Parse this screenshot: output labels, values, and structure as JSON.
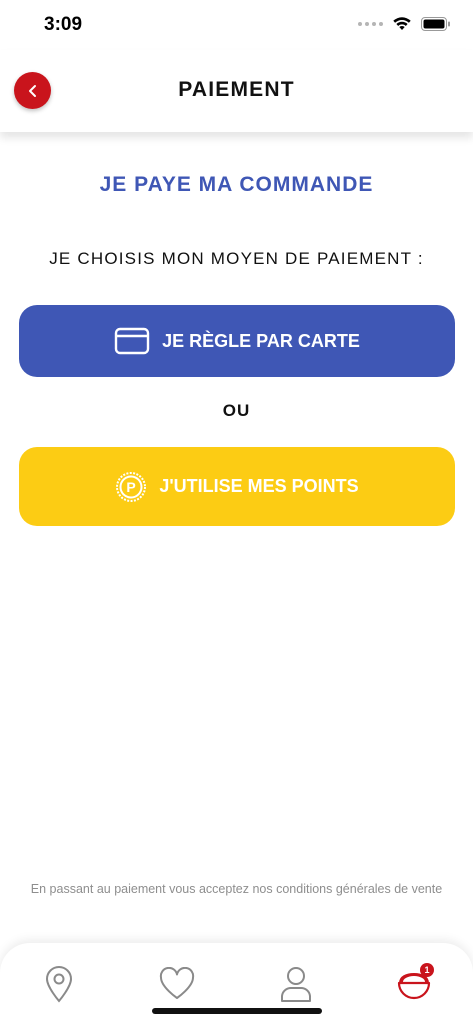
{
  "status_bar": {
    "time": "3:09"
  },
  "header": {
    "title": "PAIEMENT",
    "back_icon": "chevron-left-icon"
  },
  "main": {
    "heading": "JE PAYE MA COMMANDE",
    "choose_label": "JE CHOISIS MON MOYEN DE PAIEMENT :",
    "card_button": {
      "label": "JE RÈGLE PAR CARTE",
      "icon": "credit-card-icon",
      "color": "#3f57b5"
    },
    "or_label": "OU",
    "points_button": {
      "label": "J'UTILISE MES POINTS",
      "icon": "points-coin-icon",
      "color": "#fccc14"
    },
    "terms": "En passant au paiement vous acceptez nos conditions générales de vente"
  },
  "bottom_nav": {
    "items": [
      {
        "icon": "map-pin-icon"
      },
      {
        "icon": "heart-icon"
      },
      {
        "icon": "user-icon"
      },
      {
        "icon": "cart-icon"
      }
    ],
    "cart_badge": "1",
    "accent": "#c9141c"
  }
}
